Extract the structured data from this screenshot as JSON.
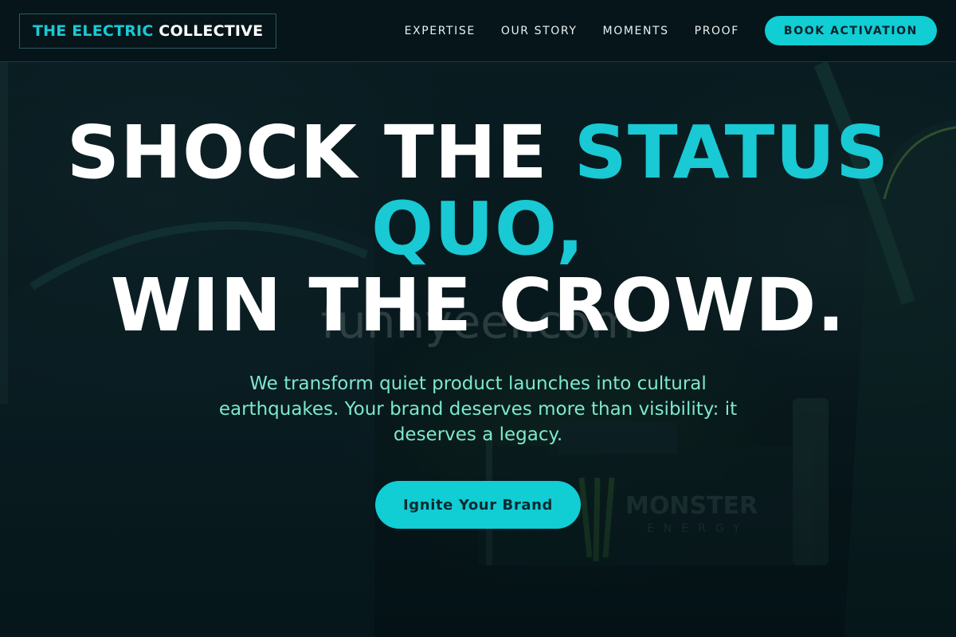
{
  "brand": {
    "name_part1": "THE ELECTRIC",
    "name_part2": "COLLECTIVE",
    "accent_color": "#19c9d4"
  },
  "nav": {
    "items": [
      {
        "label": "EXPERTISE"
      },
      {
        "label": "OUR STORY"
      },
      {
        "label": "MOMENTS"
      },
      {
        "label": "PROOF"
      }
    ],
    "cta_label": "BOOK ACTIVATION"
  },
  "hero": {
    "headline_part1": "SHOCK THE ",
    "headline_accent": "STATUS QUO,",
    "headline_part2": "WIN THE CROWD.",
    "subtitle": "We transform quiet product launches into cultural earthquakes. Your brand deserves more than visibility: it deserves a legacy.",
    "cta_label": "Ignite Your Brand",
    "watermark": "funnyeel.com"
  },
  "colors": {
    "background": "#06171b",
    "accent": "#11cdd4",
    "subtitle": "#7ee8cf"
  }
}
